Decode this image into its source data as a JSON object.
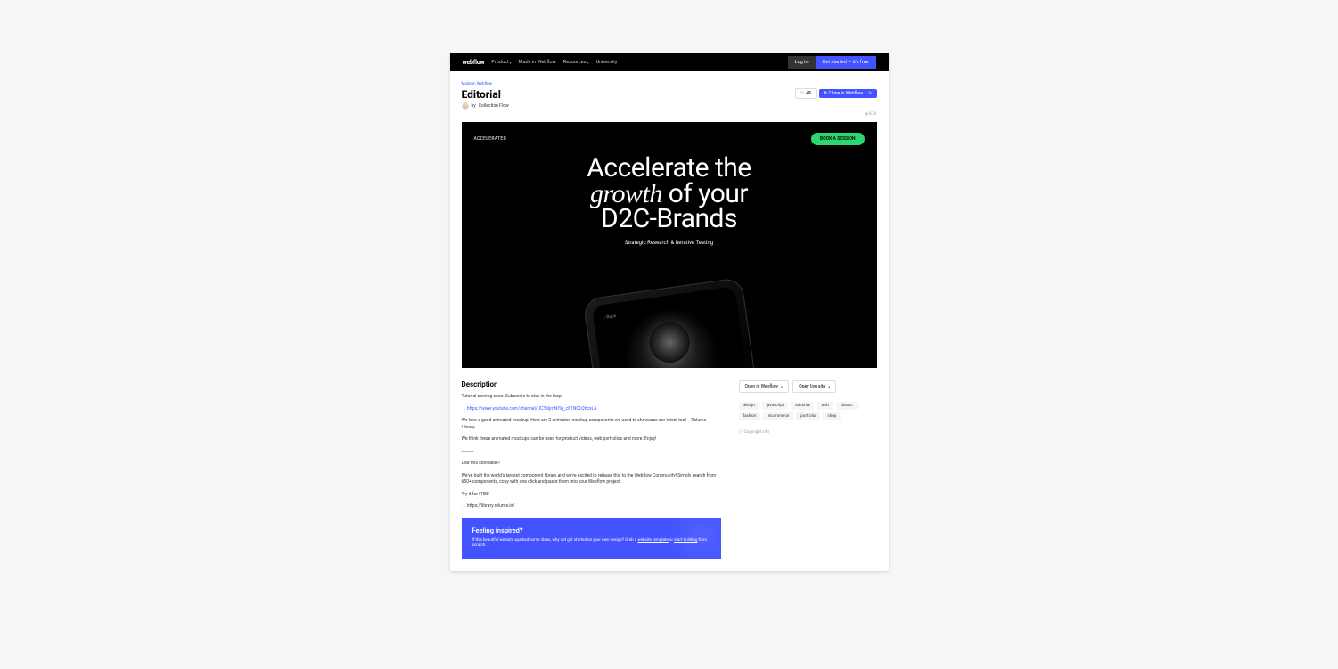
{
  "nav": {
    "logo": "webflow",
    "links": [
      "Product",
      "Made in Webflow",
      "Resources",
      "University"
    ],
    "login": "Log in",
    "cta": "Get started — it's free"
  },
  "breadcrumb": "Made in Webflow",
  "title": "Editorial",
  "author": {
    "by": "by",
    "name": "Collection Flow"
  },
  "likes": "45",
  "clone": {
    "label": "Clone in Webflow",
    "count": "1.3k"
  },
  "views": "8.7k",
  "preview": {
    "brand": "ACCELERATED",
    "book": "BOOK A SESSION",
    "line1": "Accelerate the",
    "growth": "growth",
    "line2_rest": " of your",
    "line3": "D2C-Brands",
    "sub": "Strategic Research & Iterative Testing",
    "back": "‹ Back"
  },
  "desc": {
    "title": "Description",
    "p1": "Tutorial coming soon. Subscribe to stay in the loop",
    "p2_link": "→ https://www.youtube.com/channel/UC36ljmNYlg_c81NOLQhcxLA",
    "p3": "We love a good animated mockup. Here are 2 animated mockup components we used to showcase our latest tool – Relume Library.",
    "p4": "We think these animated mockups can be used for product videos, web portfolios and more. Enjoy!",
    "dashes": "----------",
    "p5": "Like this cloneable?",
    "p6": "We've built the world's largest component library and we're excited to release this to the Webflow Community! Simply search from 650+ components, copy with one click and paste them into your Webflow project.",
    "p7": "Try it for FREE",
    "p8": "→ https://library.relume.io/"
  },
  "sidebar": {
    "open_webflow": "Open in Webflow",
    "open_live": "Open live site",
    "tags": [
      "design",
      "javascript",
      "editorial",
      "web",
      "classic",
      "fashion",
      "ecommerce",
      "portfolio",
      "shop"
    ],
    "copyright": "Copyright info"
  },
  "inspired": {
    "title": "Feeling inspired?",
    "text_pre": "If this beautiful website sparked some ideas, why not get started on your own design? Grab a ",
    "link1": "website template",
    "or": " or ",
    "link2": "start building",
    "text_post": " from scratch."
  }
}
